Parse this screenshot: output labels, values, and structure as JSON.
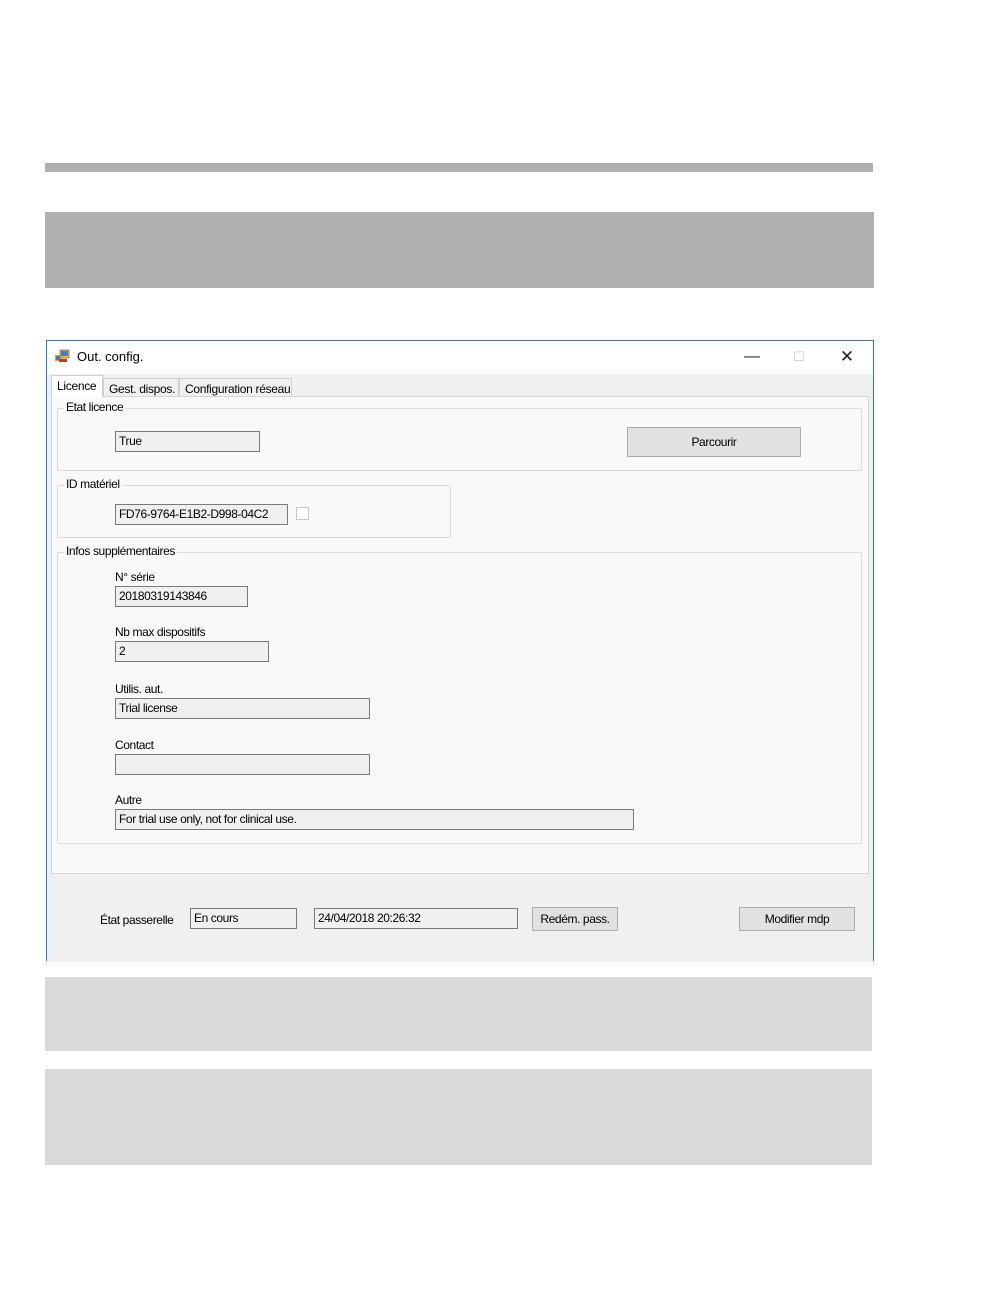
{
  "window": {
    "title": "Out. config.",
    "controls": {
      "minimize": "—",
      "maximize": "☐",
      "close": "✕"
    }
  },
  "tabs": [
    {
      "label": "Licence",
      "active": true
    },
    {
      "label": "Gest. dispos.",
      "active": false
    },
    {
      "label": "Configuration réseau",
      "active": false
    }
  ],
  "licence_state": {
    "group_label": "Etat licence",
    "value": "True",
    "browse_button": "Parcourir"
  },
  "hardware_id": {
    "group_label": "ID matériel",
    "value": "FD76-9764-E1B2-D998-04C2",
    "checked": false
  },
  "extra_info": {
    "group_label": "Infos supplémentaires",
    "serial": {
      "label": "N° série",
      "value": "20180319143846"
    },
    "max_devices": {
      "label": "Nb max dispositifs",
      "value": "2"
    },
    "authorized_user": {
      "label": "Utilis. aut.",
      "value": "Trial license"
    },
    "contact": {
      "label": "Contact",
      "value": ""
    },
    "other": {
      "label": "Autre",
      "value": "For trial use only, not for clinical use."
    }
  },
  "footer": {
    "gateway_state_label": "État passerelle",
    "gateway_state_value": "En cours",
    "gateway_timestamp": "24/04/2018 20:26:32",
    "restart_button": "Redém. pass.",
    "change_password_button": "Modifier mdp"
  },
  "colors": {
    "window_border": "#2b79c2",
    "placeholder_dark": "#b0b0b0",
    "placeholder_light": "#d9d9d9"
  }
}
